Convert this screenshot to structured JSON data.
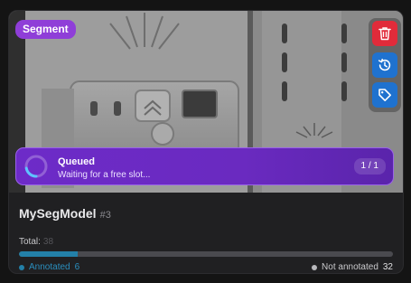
{
  "card": {
    "type_badge": "Segment",
    "model_name": "MySegModel",
    "model_number": "#3"
  },
  "actions": [
    {
      "name": "delete",
      "icon": "trash-icon",
      "color": "#e12b3a"
    },
    {
      "name": "history",
      "icon": "history-icon",
      "color": "#1f72cf"
    },
    {
      "name": "tags",
      "icon": "tag-icon",
      "color": "#1f72cf"
    }
  ],
  "queue": {
    "status": "Queued",
    "message": "Waiting for a free slot...",
    "position": "1 / 1"
  },
  "stats": {
    "total_label": "Total:",
    "total_value": "38",
    "annotated_label": "Annotated",
    "annotated_value": "6",
    "not_annotated_label": "Not annotated",
    "not_annotated_value": "32",
    "annotated_fraction": 0.158
  },
  "colors": {
    "badge": "#8f3ed8",
    "queue_banner": "#6d2bc8",
    "annotated": "#2380a8",
    "not_annotated": "#4a4a4f"
  }
}
